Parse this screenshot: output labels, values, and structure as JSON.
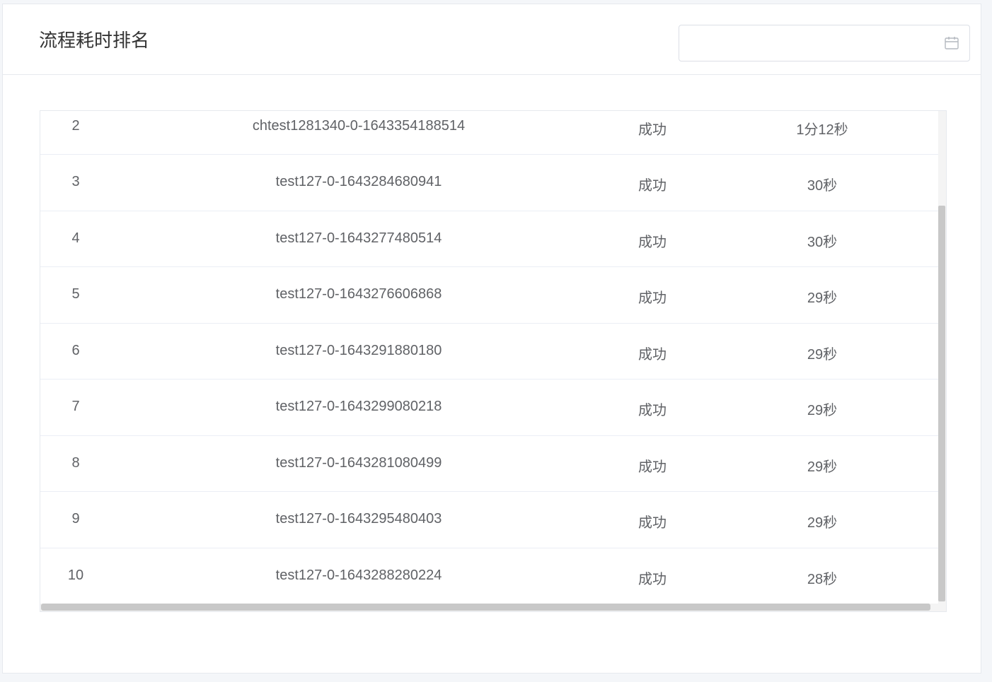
{
  "panel": {
    "title": "流程耗时排名"
  },
  "date_picker": {
    "value": "",
    "icon": "calendar-icon"
  },
  "table": {
    "rows": [
      {
        "rank": "2",
        "name": "chtest1281340-0-1643354188514",
        "status": "成功",
        "duration": "1分12秒"
      },
      {
        "rank": "3",
        "name": "test127-0-1643284680941",
        "status": "成功",
        "duration": "30秒"
      },
      {
        "rank": "4",
        "name": "test127-0-1643277480514",
        "status": "成功",
        "duration": "30秒"
      },
      {
        "rank": "5",
        "name": "test127-0-1643276606868",
        "status": "成功",
        "duration": "29秒"
      },
      {
        "rank": "6",
        "name": "test127-0-1643291880180",
        "status": "成功",
        "duration": "29秒"
      },
      {
        "rank": "7",
        "name": "test127-0-1643299080218",
        "status": "成功",
        "duration": "29秒"
      },
      {
        "rank": "8",
        "name": "test127-0-1643281080499",
        "status": "成功",
        "duration": "29秒"
      },
      {
        "rank": "9",
        "name": "test127-0-1643295480403",
        "status": "成功",
        "duration": "29秒"
      },
      {
        "rank": "10",
        "name": "test127-0-1643288280224",
        "status": "成功",
        "duration": "28秒"
      }
    ]
  }
}
